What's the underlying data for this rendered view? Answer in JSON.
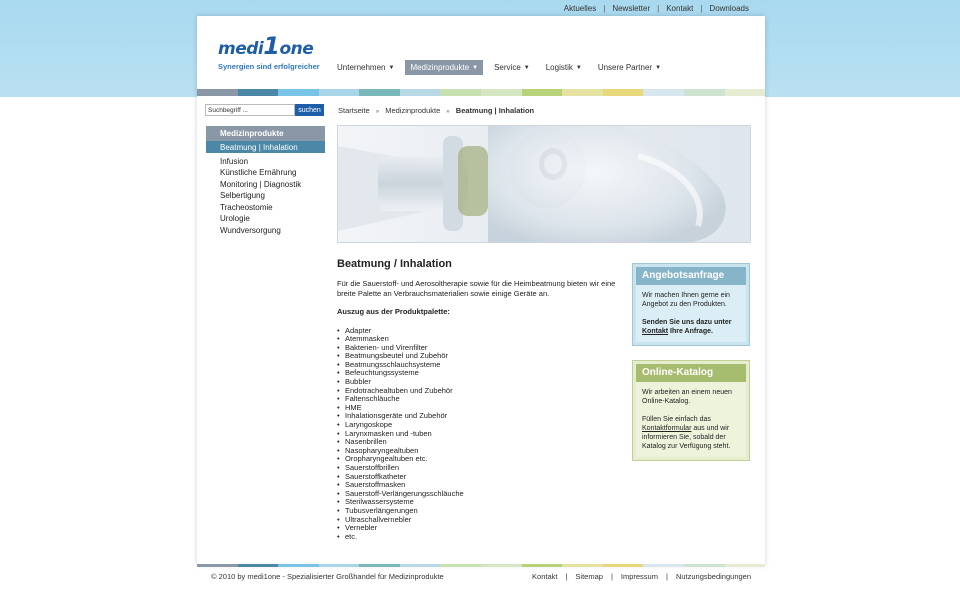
{
  "topnav": {
    "links": [
      "Aktuelles",
      "Newsletter",
      "Kontakt",
      "Downloads"
    ],
    "separator": "|"
  },
  "logo": {
    "text_medi": "medi",
    "text_one_digit": "1",
    "text_one": "one",
    "slogan": "Synergien sind erfolgreicher"
  },
  "mainnav": {
    "items": [
      {
        "label": "Unternehmen"
      },
      {
        "label": "Medizinprodukte"
      },
      {
        "label": "Service"
      },
      {
        "label": "Logistik"
      },
      {
        "label": "Unsere Partner"
      }
    ],
    "active_index": 1
  },
  "search": {
    "placeholder": "Suchbegriff ...",
    "value": "Suchbegriff ...",
    "button": "suchen"
  },
  "sidenav": {
    "heading": "Medizinprodukte",
    "items": [
      "Beatmung | Inhalation",
      "Infusion",
      "Künstliche Ernährung",
      "Monitoring | Diagnostik",
      "Selbertigung",
      "Tracheostomie",
      "Urologie",
      "Wundversorgung"
    ],
    "active_index": 0
  },
  "breadcrumb": {
    "items": [
      "Startseite",
      "Medizinprodukte",
      "Beatmung | Inhalation"
    ],
    "separator": "»"
  },
  "content": {
    "title": "Beatmung / Inhalation",
    "intro": "Für die Sauerstoff- und Aerosoltherapie sowie für die Heimbeatmung bieten wir eine breite Palette an Verbrauchsmaterialien sowie einige Geräte an.",
    "list_heading": "Auszug aus der Produktpalette:",
    "products": [
      "Adapter",
      "Atemmasken",
      "Bakterien- und Virenfilter",
      "Beatmungsbeutel und Zubehör",
      "Beatmungsschlauchsysteme",
      "Befeuchtungssysteme",
      "Bubbler",
      "Endotrachealtuben und Zubehör",
      "Faltenschläuche",
      "HME",
      "Inhalationsgeräte und Zubehör",
      "Laryngoskope",
      "Larynxmasken und -tuben",
      "Nasenbrillen",
      "Nasopharyngealtuben",
      "Oropharyngealtuben etc.",
      "Sauerstoffbrillen",
      "Sauerstoffkatheter",
      "Sauerstoffmasken",
      "Sauerstoff-Verlängerungsschläuche",
      "Sterilwassersysteme",
      "Tubusverlängerungen",
      "Ultraschallvernebler",
      "Vernebler",
      "etc."
    ]
  },
  "box_offer": {
    "title": "Angebotsanfrage",
    "text": "Wir machen Ihnen gerne ein Angebot zu den Produkten.",
    "cta_before": "Senden Sie uns dazu unter",
    "cta_link": "Kontakt",
    "cta_after": "Ihre Anfrage."
  },
  "box_catalog": {
    "title": "Online-Katalog",
    "text": "Wir arbeiten an einem neuen Online-Katalog.",
    "cta_before": "Füllen Sie einfach das",
    "cta_link": "Kontaktformular",
    "cta_after": "aus und wir informieren Sie, sobald der Katalog zur Verfügung steht."
  },
  "footer": {
    "copyright": "© 2010 by medi1one - Spezialisierter Großhandel für Medizinprodukte",
    "links": [
      "Kontakt",
      "Sitemap",
      "Impressum",
      "Nutzungsbedingungen"
    ],
    "separator": "|"
  },
  "colors": {
    "brand_blue": "#1e5ea8",
    "nav_active": "#8a97a6",
    "sidenav_active": "#4b87a6",
    "offer_header": "#86b4c8",
    "catalog_header": "#a6bc6f",
    "top_band": "#a9d9ef",
    "colorbar": [
      "#8a97a6",
      "#4b87a6",
      "#78c3e6",
      "#a8d6e8",
      "#7ab7b8",
      "#b9d8e6",
      "#c6e0b0",
      "#d6e6c2",
      "#b8d27a",
      "#e6e3a2",
      "#e8d87c",
      "#d8e7ef",
      "#cfe4d0",
      "#e5ecd2"
    ]
  }
}
